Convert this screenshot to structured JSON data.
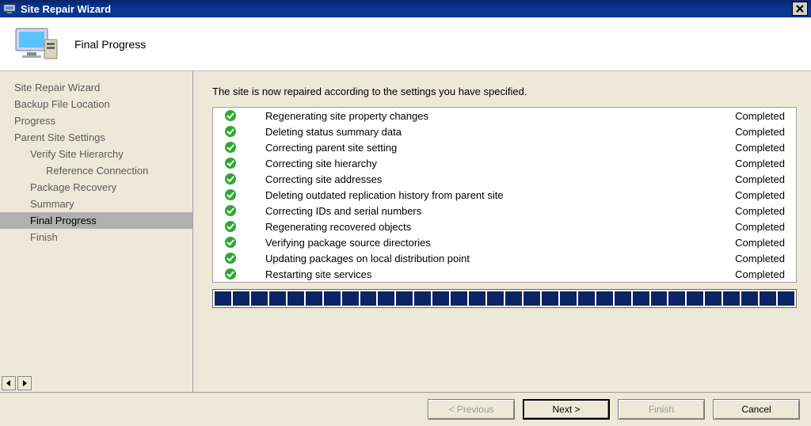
{
  "window": {
    "title": "Site Repair Wizard"
  },
  "header": {
    "title": "Final Progress"
  },
  "sidebar": {
    "items": [
      {
        "label": "Site Repair Wizard",
        "indent": 0,
        "selected": false
      },
      {
        "label": "Backup File Location",
        "indent": 0,
        "selected": false
      },
      {
        "label": "Progress",
        "indent": 0,
        "selected": false
      },
      {
        "label": "Parent Site Settings",
        "indent": 0,
        "selected": false
      },
      {
        "label": "Verify Site Hierarchy",
        "indent": 1,
        "selected": false
      },
      {
        "label": "Reference Connection",
        "indent": 2,
        "selected": false
      },
      {
        "label": "Package Recovery",
        "indent": 1,
        "selected": false
      },
      {
        "label": "Summary",
        "indent": 1,
        "selected": false
      },
      {
        "label": "Final Progress",
        "indent": 1,
        "selected": true
      },
      {
        "label": "Finish",
        "indent": 1,
        "selected": false
      }
    ]
  },
  "main": {
    "message": "The site is now repaired according to the settings you have specified.",
    "tasks": [
      {
        "text": "Regenerating site property changes",
        "status": "Completed"
      },
      {
        "text": "Deleting status summary data",
        "status": "Completed"
      },
      {
        "text": "Correcting parent site setting",
        "status": "Completed"
      },
      {
        "text": "Correcting site hierarchy",
        "status": "Completed"
      },
      {
        "text": "Correcting site addresses",
        "status": "Completed"
      },
      {
        "text": "Deleting outdated replication history from parent site",
        "status": "Completed"
      },
      {
        "text": "Correcting IDs and serial numbers",
        "status": "Completed"
      },
      {
        "text": "Regenerating recovered objects",
        "status": "Completed"
      },
      {
        "text": "Verifying package source directories",
        "status": "Completed"
      },
      {
        "text": "Updating packages on local distribution point",
        "status": "Completed"
      },
      {
        "text": "Restarting site services",
        "status": "Completed"
      }
    ],
    "progress_segments": 32
  },
  "footer": {
    "previous": "< Previous",
    "next": "Next >",
    "finish": "Finish",
    "cancel": "Cancel"
  }
}
